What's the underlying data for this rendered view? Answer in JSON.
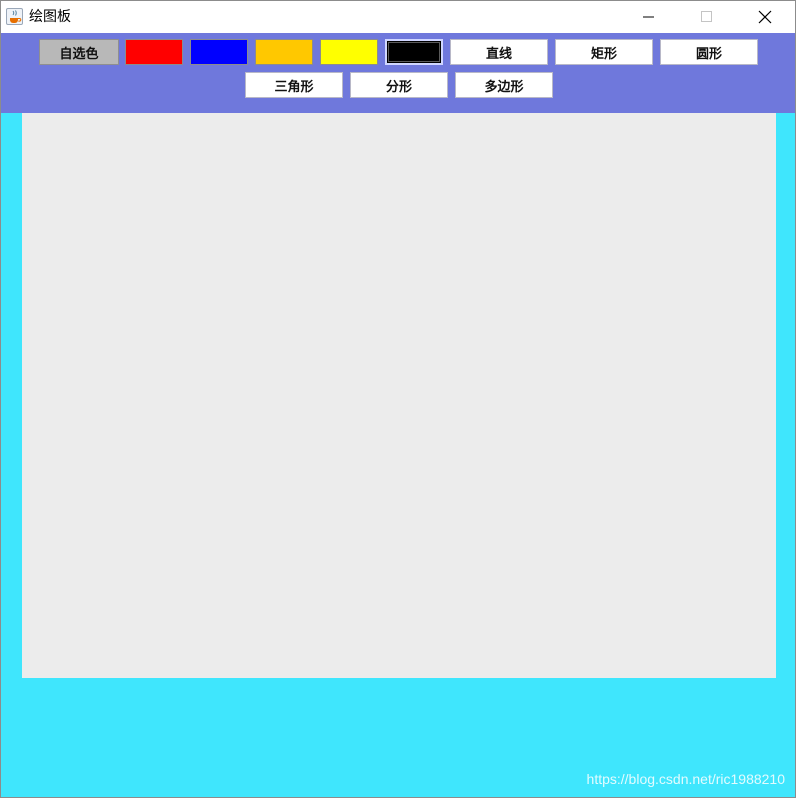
{
  "window": {
    "title": "绘图板",
    "icon": "java-cup-icon",
    "controls": [
      "minimize-icon",
      "maximize-icon",
      "close-icon"
    ]
  },
  "toolbar": {
    "background": "#6f78dc",
    "custom_color_label": "自选色",
    "swatches": [
      {
        "name": "red",
        "color": "#ff0000"
      },
      {
        "name": "blue",
        "color": "#0000ff"
      },
      {
        "name": "orange",
        "color": "#ffc800"
      },
      {
        "name": "yellow",
        "color": "#ffff00"
      },
      {
        "name": "black",
        "color": "#000000",
        "selected": true
      }
    ],
    "shapes": {
      "line": "直线",
      "rectangle": "矩形",
      "circle": "圆形",
      "triangle": "三角形",
      "fractal": "分形",
      "polygon": "多边形"
    }
  },
  "canvas": {
    "background": "#ececec",
    "frame_color": "#3fe6fd"
  },
  "watermark": "https://blog.csdn.net/ric1988210"
}
